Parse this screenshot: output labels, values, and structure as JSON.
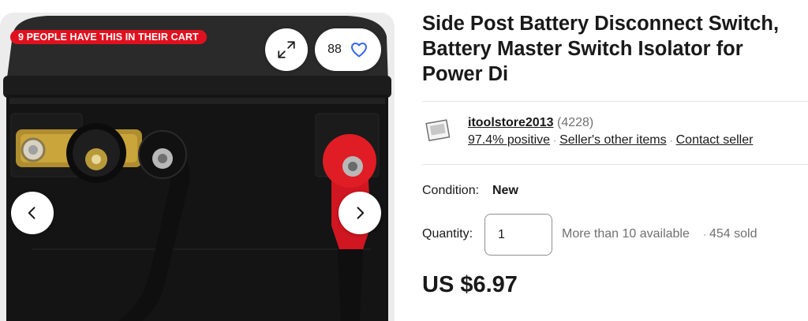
{
  "gallery": {
    "cart_badge": "9 PEOPLE HAVE THIS IN THEIR CART",
    "watch_count": "88",
    "icons": {
      "expand": "expand-arrows-icon",
      "heart": "heart-outline-icon",
      "prev": "chevron-left-icon",
      "next": "chevron-right-icon"
    },
    "colors": {
      "badge": "#e0111e",
      "heart": "#3665f3"
    }
  },
  "listing": {
    "title": "Side Post Battery Disconnect Switch, Battery Master Switch Isolator for Power Di",
    "seller": {
      "name": "itoolstore2013",
      "feedback_count": "(4228)",
      "positive": "97.4% positive",
      "other_items": "Seller's other items",
      "contact": "Contact seller"
    },
    "condition": {
      "label": "Condition:",
      "value": "New"
    },
    "quantity": {
      "label": "Quantity:",
      "value": "1",
      "available": "More than 10 available",
      "sold": "454 sold"
    },
    "price": "US $6.97"
  }
}
